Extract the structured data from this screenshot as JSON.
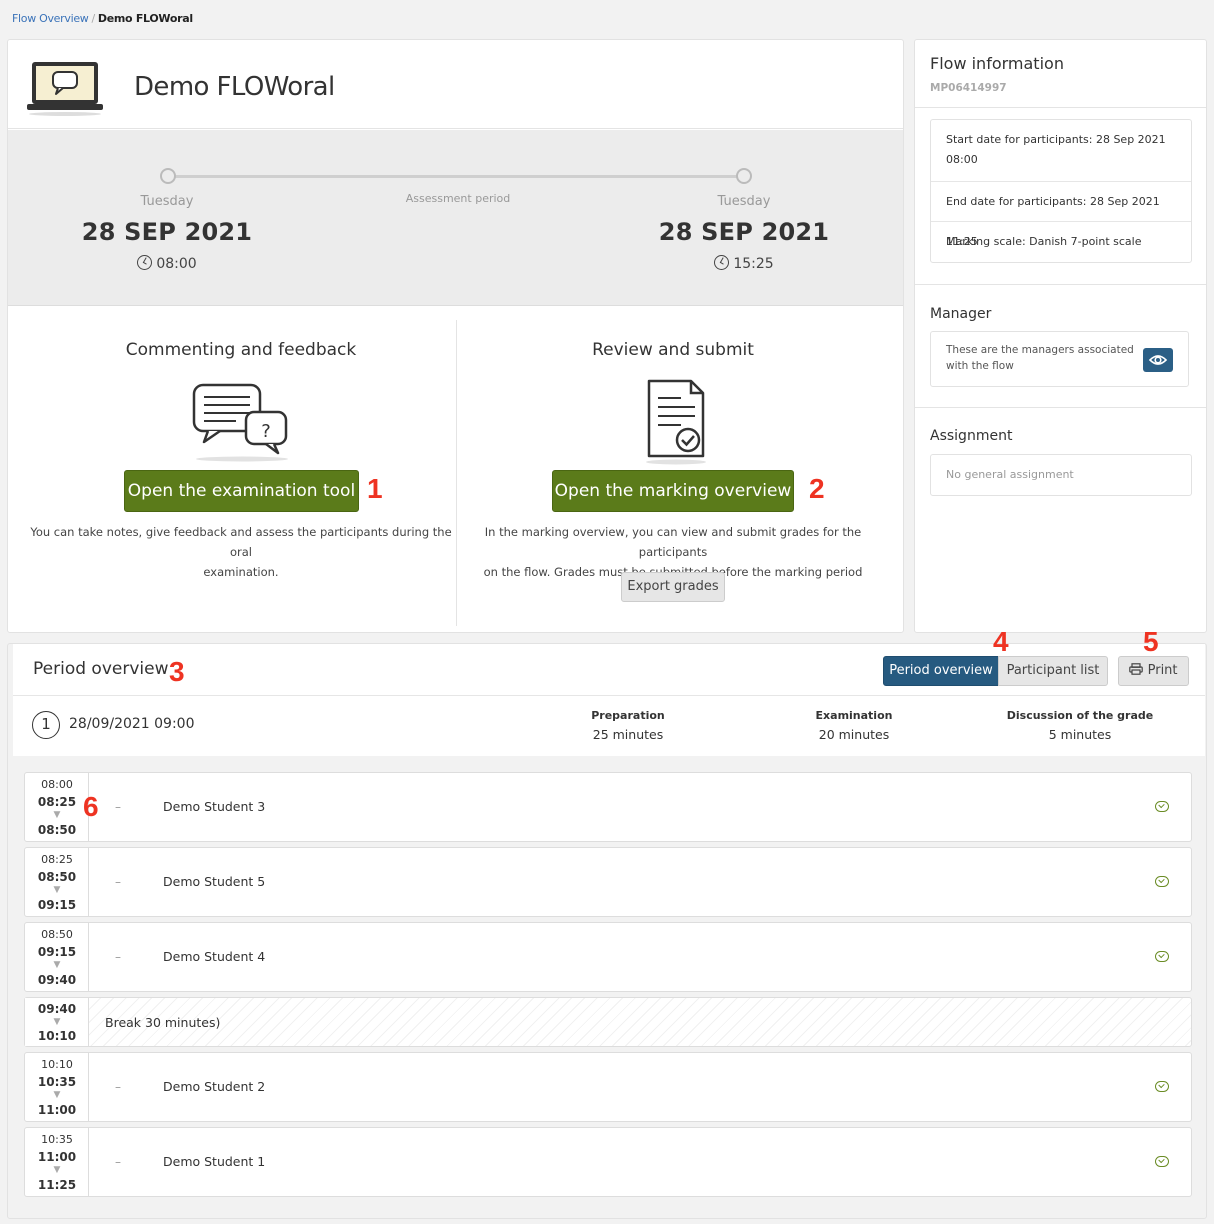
{
  "breadcrumb": {
    "parent": "Flow Overview",
    "separator": "/",
    "current": "Demo FLOWoral"
  },
  "flow": {
    "title": "Demo FLOWoral"
  },
  "period": {
    "label": "Assessment period",
    "start": {
      "day": "Tuesday",
      "date": "28 SEP 2021",
      "time": "08:00"
    },
    "end": {
      "day": "Tuesday",
      "date": "28 SEP 2021",
      "time": "15:25"
    }
  },
  "commenting": {
    "title": "Commenting and feedback",
    "button": "Open the examination tool",
    "desc1": "You can take notes, give feedback and assess the participants during the oral",
    "desc2": "examination."
  },
  "review": {
    "title": "Review and submit",
    "button": "Open the marking overview",
    "desc1": "In the marking overview, you can view and submit grades for the participants",
    "desc2": "on the flow. Grades must be submitted before the marking period ends.",
    "export": "Export grades"
  },
  "annotations": [
    "1",
    "2",
    "3",
    "4",
    "5",
    "6"
  ],
  "info": {
    "title": "Flow information",
    "code": "MP06414997",
    "start_line1": "Start date for participants: 28 Sep 2021",
    "start_line2": "08:00",
    "end": "End date for participants: 28 Sep 2021 11:25",
    "scale": "Marking scale: Danish 7-point scale"
  },
  "manager": {
    "title": "Manager",
    "line1": "These are the managers associated",
    "line2": "with the flow"
  },
  "assignment": {
    "title": "Assignment",
    "empty": "No general assignment"
  },
  "overview": {
    "title": "Period overview",
    "tabs": {
      "period": "Period overview",
      "participants": "Participant list",
      "print": "Print"
    },
    "slot": {
      "number": "1",
      "date": "28/09/2021 09:00",
      "prep_label": "Preparation",
      "prep_value": "25 minutes",
      "exam_label": "Examination",
      "exam_value": "20 minutes",
      "disc_label": "Discussion of the grade",
      "disc_value": "5 minutes"
    },
    "rows": [
      {
        "t1": "08:00",
        "t2": "08:25",
        "t3": "08:50",
        "dash": "–",
        "name": "Demo Student 3"
      },
      {
        "t1": "08:25",
        "t2": "08:50",
        "t3": "09:15",
        "dash": "–",
        "name": "Demo Student 5"
      },
      {
        "t1": "08:50",
        "t2": "09:15",
        "t3": "09:40",
        "dash": "–",
        "name": "Demo Student 4"
      },
      {
        "t2": "09:40",
        "t3": "10:10",
        "name": "Break 30 minutes)"
      },
      {
        "t1": "10:10",
        "t2": "10:35",
        "t3": "11:00",
        "dash": "–",
        "name": "Demo Student 2"
      },
      {
        "t1": "10:35",
        "t2": "11:00",
        "t3": "11:25",
        "dash": "–",
        "name": "Demo Student 1"
      }
    ]
  }
}
